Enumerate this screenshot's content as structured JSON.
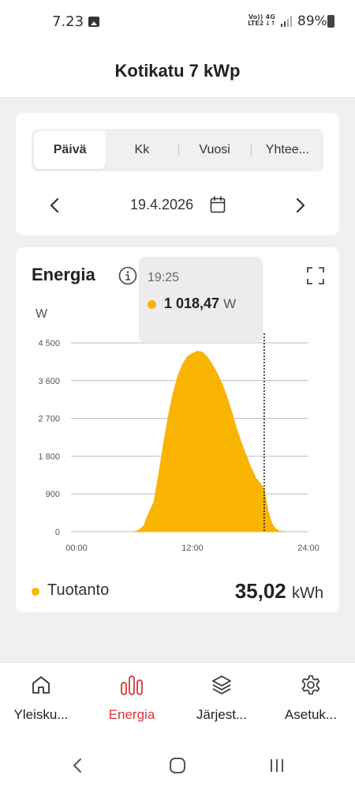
{
  "status": {
    "time": "7.23",
    "volte_top": "Vo))",
    "volte_bottom": "LTE2",
    "net_top": "4G",
    "net_bottom": "↓↑",
    "battery": "89%"
  },
  "header": {
    "title": "Kotikatu 7 kWp"
  },
  "period_tabs": [
    {
      "label": "Päivä",
      "active": true
    },
    {
      "label": "Kk",
      "active": false
    },
    {
      "label": "Vuosi",
      "active": false
    },
    {
      "label": "Yhtee...",
      "active": false
    }
  ],
  "date_nav": {
    "date": "19.4.2026"
  },
  "energy_card": {
    "title": "Energia",
    "unit_label": "W",
    "tooltip": {
      "time": "19:25",
      "value": "1 018,47",
      "unit": "W"
    },
    "legend": {
      "series": "Tuotanto",
      "total": "35,02",
      "total_unit": "kWh"
    }
  },
  "chart_data": {
    "type": "area",
    "ylabel": "W",
    "yticks": [
      "4 500",
      "3 600",
      "2 700",
      "1 800",
      "900",
      "0"
    ],
    "ytick_values": [
      4500,
      3600,
      2700,
      1800,
      900,
      0
    ],
    "xticks": [
      "00:00",
      "12:00",
      "24:00"
    ],
    "xtick_values": [
      0,
      12,
      24
    ],
    "xlim": [
      0,
      24
    ],
    "ylim": [
      0,
      4500
    ],
    "grid": true,
    "cursor_hour": 19.42,
    "color": "#f8b400",
    "series": [
      {
        "name": "Tuotanto",
        "x": [
          6.0,
          6.5,
          7.0,
          7.3,
          7.6,
          8.0,
          8.5,
          9.0,
          9.5,
          10.0,
          10.5,
          11.0,
          11.5,
          12.0,
          12.5,
          13.0,
          13.5,
          14.0,
          14.5,
          15.0,
          15.5,
          16.0,
          16.5,
          17.0,
          17.5,
          18.0,
          18.5,
          19.0,
          19.42,
          19.8,
          20.2,
          20.6,
          21.0,
          21.5
        ],
        "y": [
          0,
          40,
          150,
          350,
          500,
          700,
          1350,
          2100,
          2750,
          3300,
          3720,
          4000,
          4180,
          4250,
          4300,
          4280,
          4170,
          4000,
          3800,
          3550,
          3250,
          2900,
          2500,
          2150,
          1850,
          1550,
          1300,
          1150,
          1018,
          500,
          200,
          60,
          15,
          0
        ]
      }
    ]
  },
  "bottom_nav": [
    {
      "label": "Yleisku...",
      "icon": "home-icon",
      "active": false
    },
    {
      "label": "Energia",
      "icon": "bar-chart-icon",
      "active": true
    },
    {
      "label": "Järjest...",
      "icon": "layers-icon",
      "active": false
    },
    {
      "label": "Asetuk...",
      "icon": "gear-icon",
      "active": false
    }
  ],
  "colors": {
    "accent": "#d8343c",
    "production": "#f8b400"
  }
}
